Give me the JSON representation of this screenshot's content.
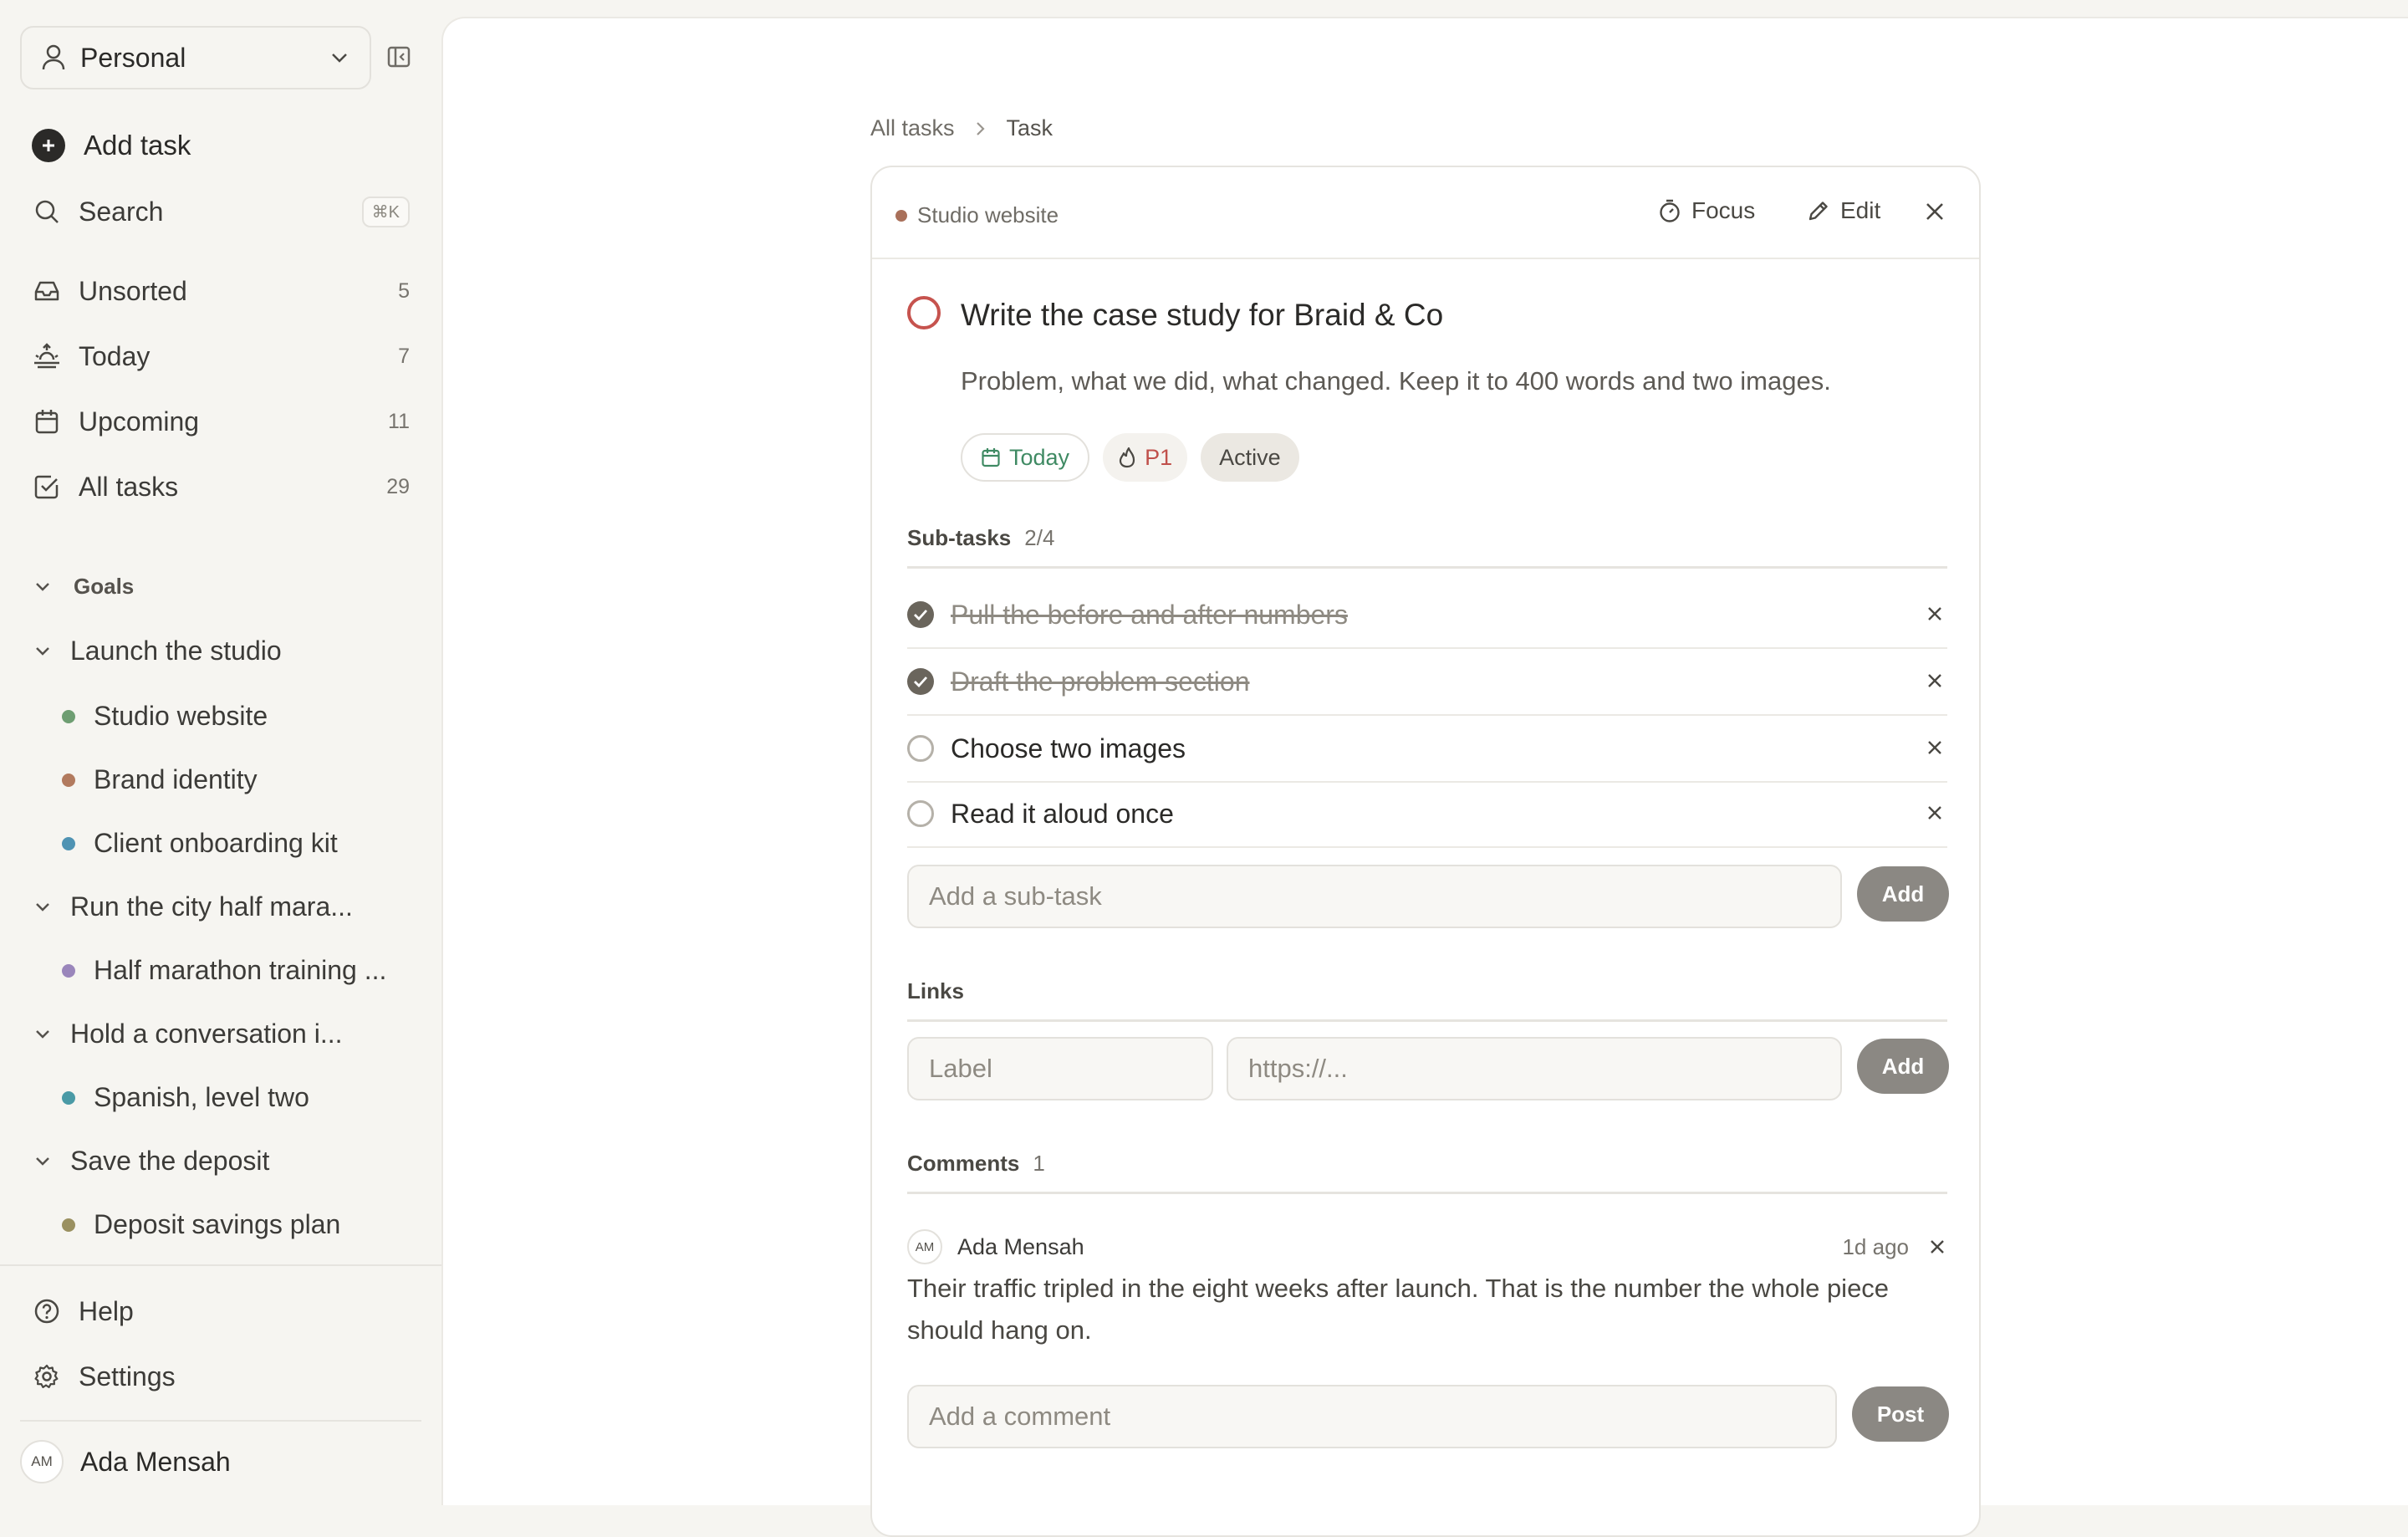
{
  "sidebar": {
    "workspace": "Personal",
    "add_task": "Add task",
    "search": {
      "label": "Search",
      "shortcut": "⌘K"
    },
    "nav": [
      {
        "label": "Unsorted",
        "count": "5"
      },
      {
        "label": "Today",
        "count": "7"
      },
      {
        "label": "Upcoming",
        "count": "11"
      },
      {
        "label": "All tasks",
        "count": "29"
      }
    ],
    "goals_header": "Goals",
    "goals": [
      {
        "label": "Launch the studio",
        "projects": [
          {
            "label": "Studio website",
            "color": "#6e9e72"
          },
          {
            "label": "Brand identity",
            "color": "#b27a5e"
          },
          {
            "label": "Client onboarding kit",
            "color": "#4f93b3"
          }
        ]
      },
      {
        "label": "Run the city half mara...",
        "projects": [
          {
            "label": "Half marathon training ...",
            "color": "#9a86bb"
          }
        ]
      },
      {
        "label": "Hold a conversation i...",
        "projects": [
          {
            "label": "Spanish, level two",
            "color": "#4a9aa6"
          }
        ]
      },
      {
        "label": "Save the deposit",
        "projects": [
          {
            "label": "Deposit savings plan",
            "color": "#9a9060"
          }
        ]
      }
    ],
    "help": "Help",
    "settings": "Settings",
    "user": {
      "initials": "AM",
      "name": "Ada Mensah"
    }
  },
  "main": {
    "breadcrumb": {
      "root": "All tasks",
      "current": "Task"
    },
    "card": {
      "project": "Studio website",
      "focus": "Focus",
      "edit": "Edit",
      "title": "Write the case study for Braid & Co",
      "description": "Problem, what we did, what changed. Keep it to 400 words and two images.",
      "chips": {
        "date": "Today",
        "priority": "P1",
        "status": "Active"
      },
      "subtasks": {
        "header": "Sub-tasks",
        "count": "2/4",
        "items": [
          {
            "label": "Pull the before and after numbers",
            "done": true
          },
          {
            "label": "Draft the problem section",
            "done": true
          },
          {
            "label": "Choose two images",
            "done": false
          },
          {
            "label": "Read it aloud once",
            "done": false
          }
        ],
        "input_placeholder": "Add a sub-task",
        "add": "Add"
      },
      "links": {
        "header": "Links",
        "label_placeholder": "Label",
        "url_placeholder": "https://...",
        "add": "Add"
      },
      "comments": {
        "header": "Comments",
        "count": "1",
        "items": [
          {
            "initials": "AM",
            "author": "Ada Mensah",
            "time": "1d  ago",
            "text": "Their traffic tripled in the eight weeks after launch. That is the number the whole piece should hang on."
          }
        ],
        "input_placeholder": "Add a comment",
        "post": "Post"
      }
    }
  }
}
